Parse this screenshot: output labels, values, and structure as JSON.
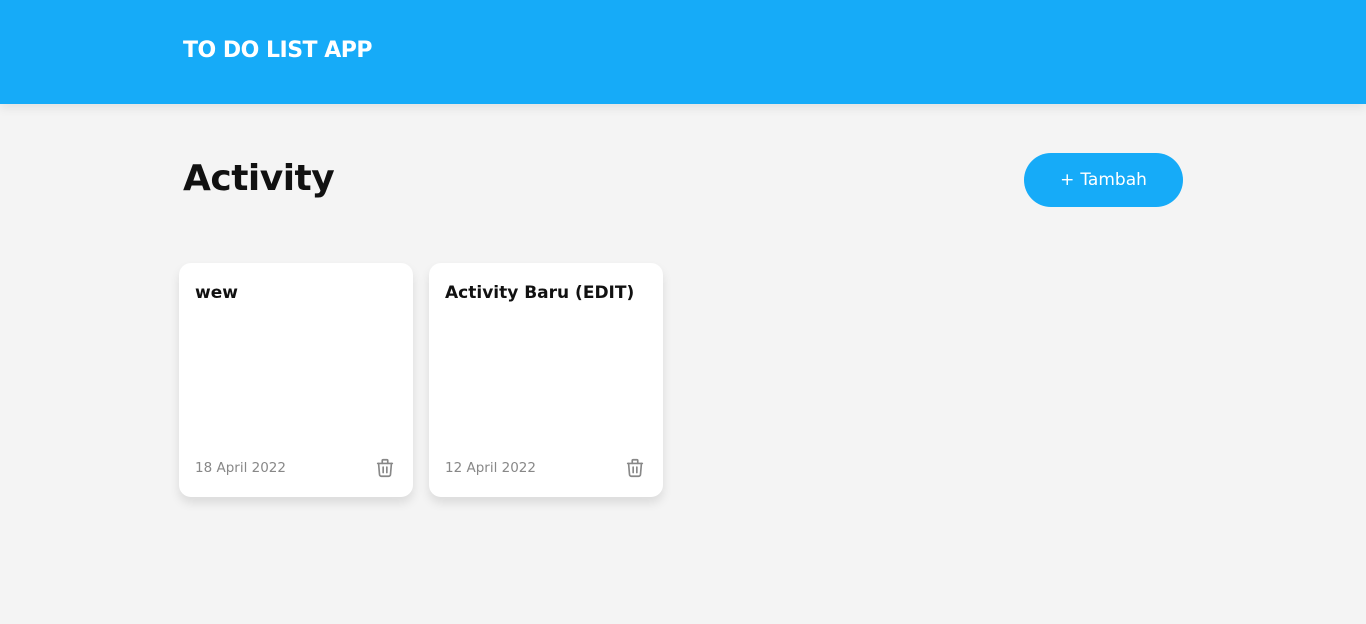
{
  "header": {
    "title": "TO DO LIST APP"
  },
  "main": {
    "title": "Activity",
    "add_button": {
      "plus": "+",
      "label": "Tambah"
    },
    "activities": [
      {
        "title": "wew",
        "date": "18 April 2022",
        "delete_icon": "trash-icon"
      },
      {
        "title": "Activity Baru (EDIT)",
        "date": "12 April 2022",
        "delete_icon": "trash-icon"
      }
    ]
  },
  "colors": {
    "primary": "#16abf8",
    "background": "#f4f4f4",
    "card": "#ffffff",
    "muted_text": "#888888"
  }
}
